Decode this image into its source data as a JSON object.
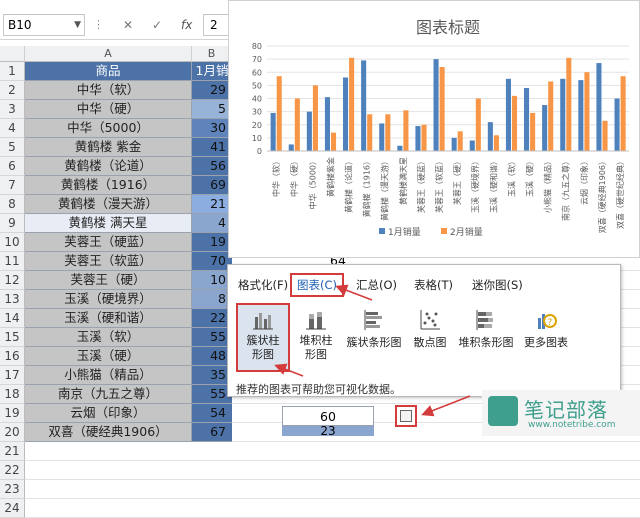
{
  "formula_bar": {
    "name_box": "B10",
    "fx": "fx",
    "cancel": "✕",
    "confirm": "✓",
    "value": "2"
  },
  "columns": {
    "a": "A",
    "b": "B"
  },
  "rows": [
    {
      "num": "1",
      "a": "商品",
      "b": "1月销"
    },
    {
      "num": "2",
      "a": "中华（软）",
      "b": "29"
    },
    {
      "num": "3",
      "a": "中华（硬）",
      "b": "5"
    },
    {
      "num": "4",
      "a": "中华（5000）",
      "b": "30"
    },
    {
      "num": "5",
      "a": "黄鹤楼 紫金",
      "b": "41"
    },
    {
      "num": "6",
      "a": "黄鹤楼（论道）",
      "b": "56"
    },
    {
      "num": "7",
      "a": "黄鹤楼（1916）",
      "b": "69"
    },
    {
      "num": "8",
      "a": "黄鹤楼（漫天游）",
      "b": "21"
    },
    {
      "num": "9",
      "a": "黄鹤楼 满天星",
      "b": "4"
    },
    {
      "num": "10",
      "a": "芙蓉王（硬蓝）",
      "b": "19"
    },
    {
      "num": "11",
      "a": "芙蓉王（软蓝）",
      "b": "70"
    },
    {
      "num": "12",
      "a": "芙蓉王（硬）",
      "b": "10"
    },
    {
      "num": "13",
      "a": "玉溪（硬境界）",
      "b": "8"
    },
    {
      "num": "14",
      "a": "玉溪（硬和谐）",
      "b": "22"
    },
    {
      "num": "15",
      "a": "玉溪（软）",
      "b": "55"
    },
    {
      "num": "16",
      "a": "玉溪（硬）",
      "b": "48"
    },
    {
      "num": "17",
      "a": "小熊猫（精品）",
      "b": "35"
    },
    {
      "num": "18",
      "a": "南京（九五之尊）",
      "b": "55"
    },
    {
      "num": "19",
      "a": "云烟（印象）",
      "b": "54"
    },
    {
      "num": "20",
      "a": "双喜（硬经典1906）",
      "b": "67"
    }
  ],
  "visible_row_labels": [
    "1",
    "2",
    "3",
    "4",
    "5",
    "6",
    "7",
    "8",
    "9",
    "10",
    "11",
    "12",
    "13",
    "14",
    "15",
    "16",
    "17",
    "18",
    "19",
    "20",
    "21",
    "22",
    "23",
    "24"
  ],
  "peek_values": {
    "row9_c": "64",
    "row23_c": "60",
    "row24_c": "23"
  },
  "chart_data": {
    "type": "bar",
    "title": "图表标题",
    "categories": [
      "中华（软）",
      "中华（硬）",
      "中华（5000）",
      "黄鹤楼紫金",
      "黄鹤楼（论道）",
      "黄鹤楼（1916）",
      "黄鹤楼（漫天游）",
      "黄鹤楼满天星",
      "芙蓉王（硬蓝）",
      "芙蓉王（软蓝）",
      "芙蓉王（硬）",
      "玉溪（硬境界）",
      "玉溪（硬和谐）",
      "玉溪（软）",
      "玉溪（硬）",
      "小熊猫（精品）",
      "南京（九五之尊）",
      "云烟（印象）",
      "双喜（硬经典1906）",
      "双喜（硬世纪经典）"
    ],
    "series": [
      {
        "name": "1月销量",
        "color": "#4f81bd",
        "values": [
          29,
          5,
          30,
          41,
          56,
          69,
          21,
          4,
          19,
          70,
          10,
          8,
          22,
          55,
          48,
          35,
          55,
          54,
          67,
          40
        ]
      },
      {
        "name": "2月销量",
        "color": "#f79646",
        "values": [
          57,
          40,
          50,
          14,
          71,
          28,
          28,
          31,
          20,
          64,
          15,
          40,
          12,
          42,
          29,
          53,
          71,
          60,
          23,
          57
        ]
      }
    ],
    "ylim": [
      0,
      80
    ],
    "yticks": [
      0,
      10,
      20,
      30,
      40,
      50,
      60,
      70,
      80
    ],
    "legend": "bottom",
    "grid": true
  },
  "quick_analysis": {
    "tabs": [
      {
        "label": "格式化(F)"
      },
      {
        "label": "图表(C)"
      },
      {
        "label": "汇总(O)"
      },
      {
        "label": "表格(T)"
      },
      {
        "label": "迷你图(S)"
      }
    ],
    "items": [
      {
        "label": "簇状柱形图",
        "icon": "clustered-column-icon"
      },
      {
        "label": "堆积柱形图",
        "icon": "stacked-column-icon"
      },
      {
        "label": "簇状条形图",
        "icon": "clustered-bar-icon"
      },
      {
        "label": "散点图",
        "icon": "scatter-icon"
      },
      {
        "label": "堆积条形图",
        "icon": "stacked-bar-icon"
      },
      {
        "label": "更多图表",
        "icon": "more-charts-icon"
      }
    ],
    "hint": "推荐的图表可帮助您可视化数据。"
  },
  "watermark": {
    "title": "笔记部落",
    "url": "www.notetribe.com"
  }
}
